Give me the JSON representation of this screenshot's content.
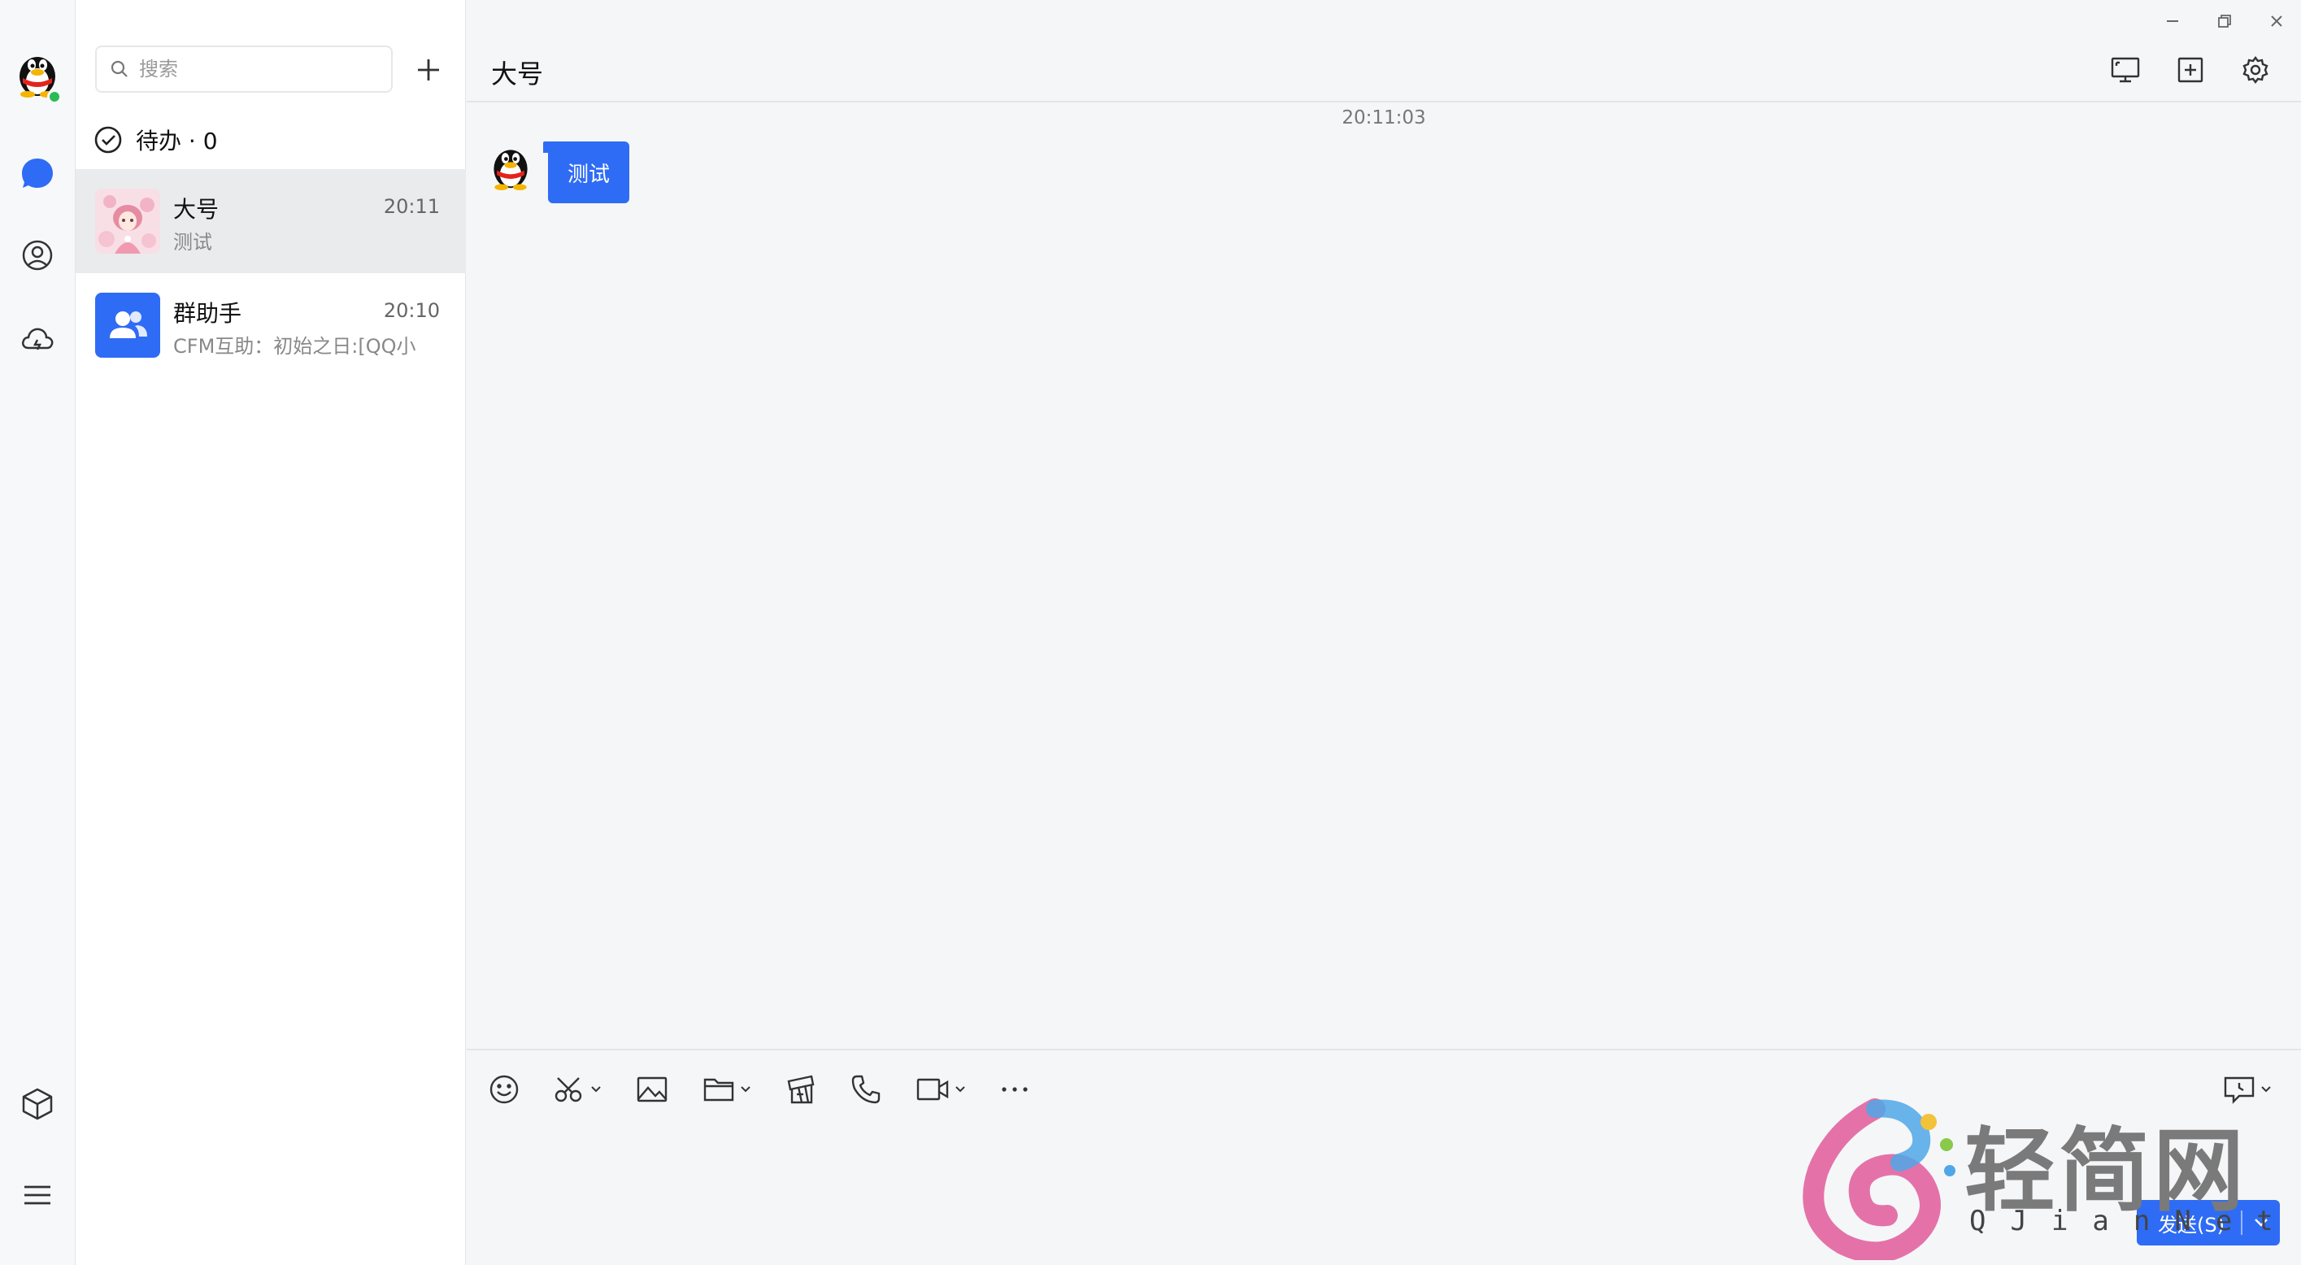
{
  "rail": {
    "items": [
      {
        "name": "messages",
        "icon": "chat-bubble-icon",
        "active": true
      },
      {
        "name": "contacts",
        "icon": "contact-icon",
        "active": false
      },
      {
        "name": "cloud",
        "icon": "cloud-icon",
        "active": false
      },
      {
        "name": "apps",
        "icon": "cube-icon",
        "active": false
      },
      {
        "name": "menu",
        "icon": "hamburger-icon",
        "active": false
      }
    ],
    "accent": "#2f6cf5",
    "status_color": "#2bbb55"
  },
  "list": {
    "search_placeholder": "搜索",
    "todo_label": "待办 · 0",
    "conversations": [
      {
        "name": "大号",
        "time": "20:11",
        "preview": "测试",
        "active": true
      },
      {
        "name": "群助手",
        "time": "20:10",
        "preview": "CFM互助：初始之日:[QQ小",
        "active": false
      }
    ]
  },
  "chat": {
    "title": "大号",
    "timestamp": "20:11:03",
    "messages": [
      {
        "text": "测试",
        "bubble_color": "#2f6cf5"
      }
    ],
    "send_label": "发送(S)"
  },
  "watermark": {
    "text": "轻简网",
    "sub": "QJianNet"
  }
}
